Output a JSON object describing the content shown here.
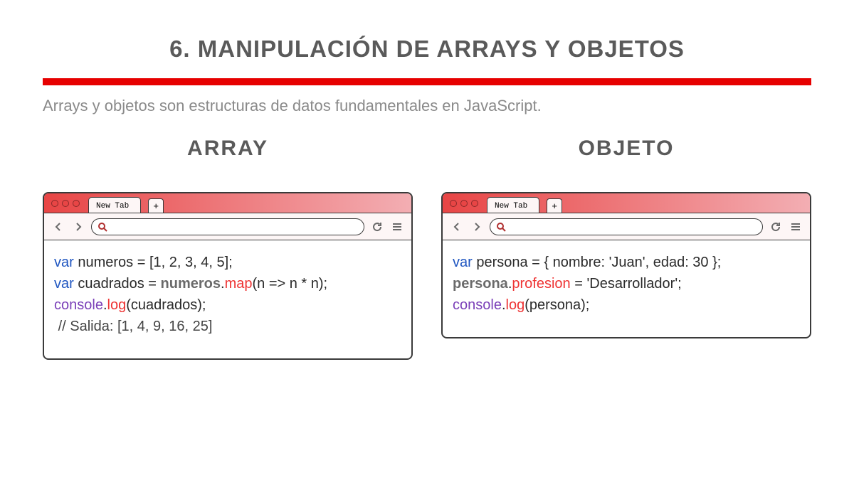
{
  "title": "6. MANIPULACIÓN DE ARRAYS Y OBJETOS",
  "subtitle": "Arrays y objetos son estructuras de datos fundamentales en JavaScript.",
  "columns": {
    "left": {
      "heading": "ARRAY",
      "tab_label": "New Tab",
      "plus": "+",
      "code": {
        "l1_var": "var",
        "l1_rest": " numeros = [1, 2, 3, 4, 5];",
        "l2_var": "var",
        "l2_a": " cuadrados = ",
        "l2_obj": "numeros",
        "l2_dot": ".",
        "l2_method": "map",
        "l2_rest": "(n => n * n);",
        "l3_console": "console",
        "l3_dot": ".",
        "l3_log": "log",
        "l3_rest": "(cuadrados);",
        "l4_comment": " // Salida: [1, 4, 9, 16, 25]"
      }
    },
    "right": {
      "heading": "OBJETO",
      "tab_label": "New Tab",
      "plus": "+",
      "code": {
        "l1_var": "var",
        "l1_rest": " persona = { nombre: 'Juan', edad: 30 };",
        "l2_obj": "persona",
        "l2_dot": ".",
        "l2_prop": "profesion",
        "l2_rest": " = 'Desarrollador';",
        "l3_console": "console",
        "l3_dot": ".",
        "l3_log": "log",
        "l3_rest": "(persona);"
      }
    }
  }
}
